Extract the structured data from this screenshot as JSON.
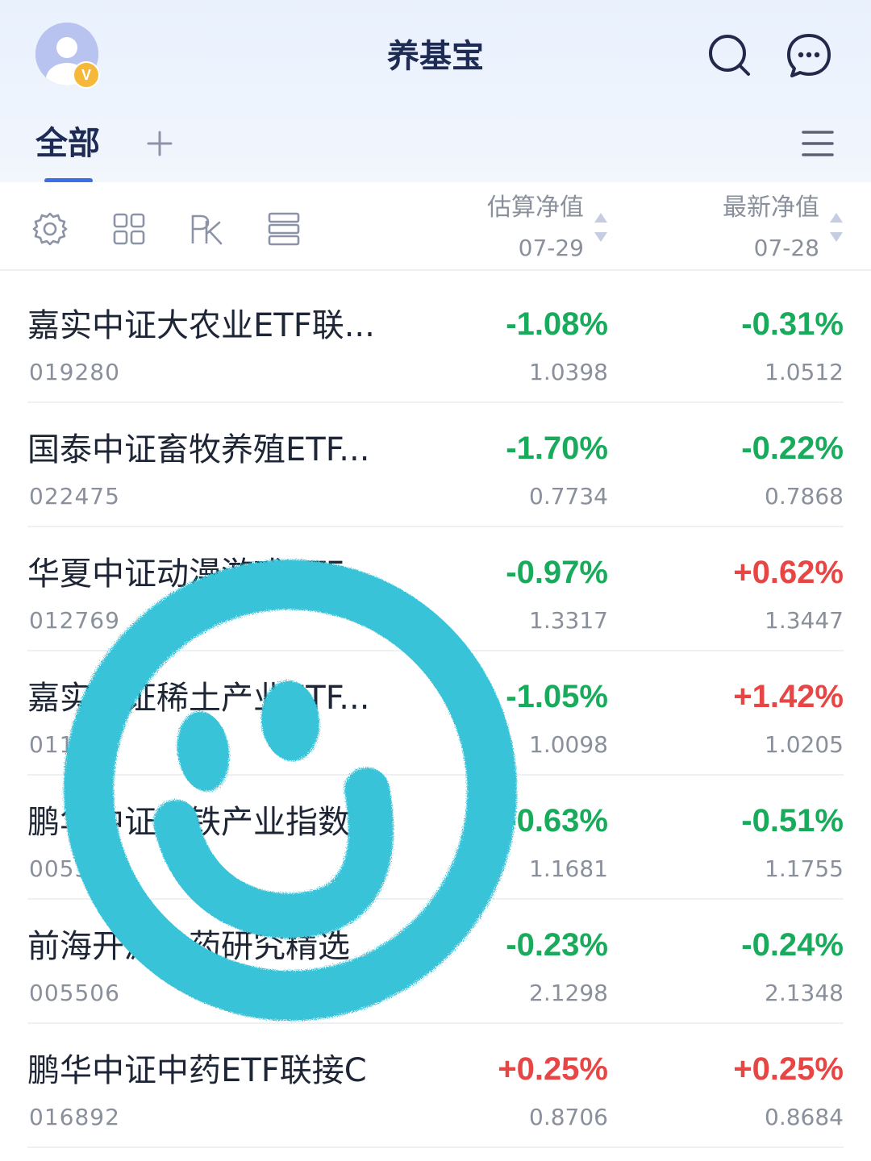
{
  "header": {
    "title": "养基宝",
    "avatar_badge": "V"
  },
  "tabs": {
    "active_label": "全部"
  },
  "columns": {
    "estimated": {
      "label": "估算净值",
      "date": "07-29"
    },
    "latest": {
      "label": "最新净值",
      "date": "07-28"
    }
  },
  "colors": {
    "up": "#e84545",
    "down": "#19ab5c",
    "accent": "#3a6fe6",
    "sticker": "#39c3d8"
  },
  "icons": {
    "top": [
      "avatar-icon",
      "search-icon",
      "message-icon"
    ],
    "tabs": [
      "add-tab-icon",
      "menu-icon"
    ],
    "toolbar": [
      "settings-icon",
      "grid-icon",
      "pk-icon",
      "list-view-icon"
    ]
  },
  "funds": [
    {
      "name": "嘉实中证大农业ETF联...",
      "code": "019280",
      "est_pct": "-1.08%",
      "est_val": "1.0398",
      "latest_pct": "-0.31%",
      "latest_val": "1.0512"
    },
    {
      "name": "国泰中证畜牧养殖ETF...",
      "code": "022475",
      "est_pct": "-1.70%",
      "est_val": "0.7734",
      "latest_pct": "-0.22%",
      "latest_val": "0.7868"
    },
    {
      "name": "华夏中证动漫游戏ETF...",
      "code": "012769",
      "est_pct": "-0.97%",
      "est_val": "1.3317",
      "latest_pct": "+0.62%",
      "latest_val": "1.3447"
    },
    {
      "name": "嘉实中证稀土产业ETF...",
      "code": "011036",
      "est_pct": "-1.05%",
      "est_val": "1.0098",
      "latest_pct": "+1.42%",
      "latest_val": "1.0205"
    },
    {
      "name": "鹏华中证高铁产业指数...",
      "code": "005378",
      "est_pct": "-0.63%",
      "est_val": "1.1681",
      "latest_pct": "-0.51%",
      "latest_val": "1.1755"
    },
    {
      "name": "前海开源中药研究精选",
      "code": "005506",
      "est_pct": "-0.23%",
      "est_val": "2.1298",
      "latest_pct": "-0.24%",
      "latest_val": "2.1348"
    },
    {
      "name": "鹏华中证中药ETF联接C",
      "code": "016892",
      "est_pct": "+0.25%",
      "est_val": "0.8706",
      "latest_pct": "+0.25%",
      "latest_val": "0.8684"
    }
  ]
}
